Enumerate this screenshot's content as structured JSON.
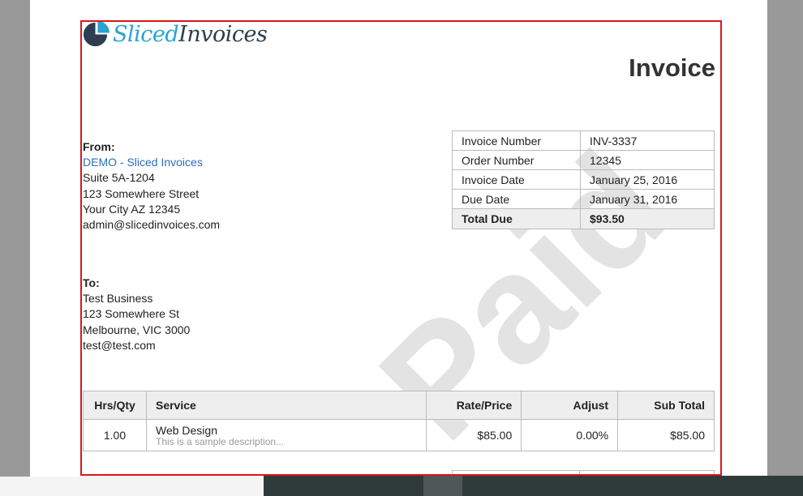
{
  "brand": {
    "logo_part1": "Sliced",
    "logo_part2": "Invoices"
  },
  "title": "Invoice",
  "watermark": "Paid",
  "details": [
    {
      "label": "Invoice Number",
      "value": "INV-3337"
    },
    {
      "label": "Order Number",
      "value": "12345"
    },
    {
      "label": "Invoice Date",
      "value": "January 25, 2016"
    },
    {
      "label": "Due Date",
      "value": "January 31, 2016"
    },
    {
      "label": "Total Due",
      "value": "$93.50"
    }
  ],
  "from": {
    "heading": "From:",
    "name": "DEMO - Sliced Invoices",
    "line1": "Suite 5A-1204",
    "line2": "123 Somewhere Street",
    "line3": "Your City AZ 12345",
    "email": "admin@slicedinvoices.com"
  },
  "to": {
    "heading": "To:",
    "name": "Test Business",
    "line1": "123 Somewhere St",
    "line2": "Melbourne, VIC 3000",
    "email": "test@test.com"
  },
  "items": {
    "headers": {
      "qty": "Hrs/Qty",
      "service": "Service",
      "rate": "Rate/Price",
      "adjust": "Adjust",
      "subtotal": "Sub Total"
    },
    "rows": [
      {
        "qty": "1.00",
        "service": "Web Design",
        "description": "This is a sample description...",
        "rate": "$85.00",
        "adjust": "0.00%",
        "subtotal": "$85.00"
      }
    ]
  },
  "colors": {
    "brand_blue": "#2aa3d0",
    "brand_dark": "#2c3e50",
    "link": "#2a6ebb",
    "frame": "#d9161b"
  }
}
